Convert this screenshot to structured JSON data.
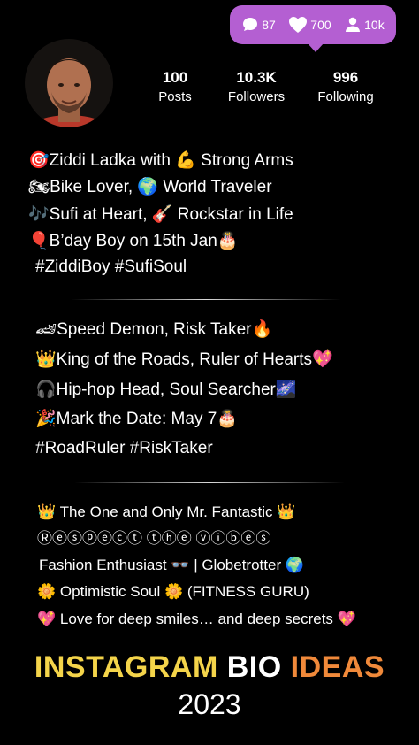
{
  "notification": {
    "comments": "87",
    "likes": "700",
    "followers": "10k",
    "bg_color": "#b45fd2"
  },
  "profile": {
    "stats": [
      {
        "value": "100",
        "label": "Posts"
      },
      {
        "value": "10.3K",
        "label": "Followers"
      },
      {
        "value": "996",
        "label": "Following"
      }
    ]
  },
  "bio_blocks": [
    {
      "lines": [
        {
          "icon": "🎯",
          "text": "Ziddi Ladka with 💪 Strong Arms"
        },
        {
          "icon": "🏍",
          "text": "Bike Lover, 🌍 World Traveler"
        },
        {
          "icon": "🎶",
          "text": "Sufi at Heart, 🎸 Rockstar in Life"
        },
        {
          "icon": "🎈",
          "text": "B’day Boy on 15th Jan🎂"
        },
        {
          "icon": "",
          "text": "#ZiddiBoy #SufiSoul"
        }
      ]
    },
    {
      "lines": [
        {
          "icon": "🏎",
          "text": "Speed Demon, Risk Taker🔥"
        },
        {
          "icon": "👑",
          "text": "King of the Roads, Ruler of Hearts💖"
        },
        {
          "icon": "🎧",
          "text": "Hip-hop Head, Soul Searcher🌌"
        },
        {
          "icon": "🎉",
          "text": "Mark the Date: May 7🎂"
        },
        {
          "icon": "",
          "text": "#RoadRuler #RiskTaker"
        }
      ]
    },
    {
      "lines": [
        {
          "icon": "👑",
          "text": "The One and Only Mr. Fantastic 👑"
        },
        {
          "icon": "",
          "text": "Ⓡⓔⓢⓟⓔⓒⓣ ⓣⓗⓔ ⓥⓘⓑⓔⓢ"
        },
        {
          "icon": "",
          "text": "Fashion Enthusiast 👓 | Globetrotter 🌍"
        },
        {
          "icon": "🌼",
          "text": "Optimistic Soul 🌼 (FITNESS GURU)"
        },
        {
          "icon": "💖",
          "text": "Love for deep smiles… and deep secrets 💖"
        }
      ]
    }
  ],
  "footer": {
    "title_part1": "INSTAGRAM",
    "title_part2": "BIO",
    "title_part3": "IDEAS",
    "year": "2023",
    "color_yellow": "#f4d44a",
    "color_white": "#ffffff",
    "color_orange": "#f0893a"
  }
}
